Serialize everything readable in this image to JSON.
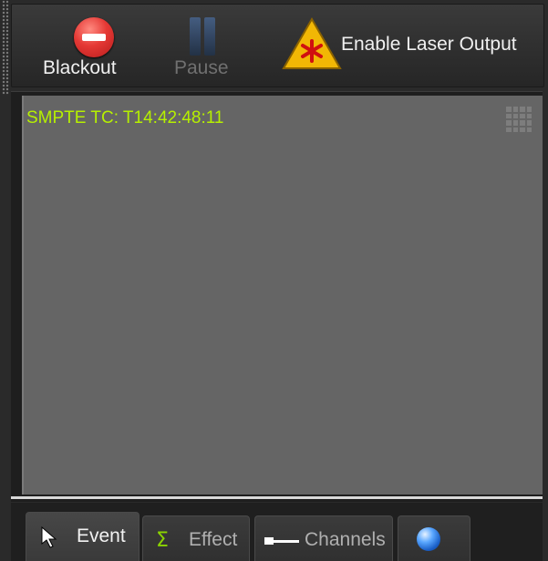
{
  "toolbar": {
    "blackout_label": "Blackout",
    "pause_label": "Pause",
    "laser_label": "Enable Laser Output"
  },
  "view": {
    "smpte": "SMPTE TC: T14:42:48:11"
  },
  "tabs": [
    {
      "label": "Event",
      "icon": "cursor-arrow-icon",
      "active": true
    },
    {
      "label": "Effect",
      "icon": "sigma-icon",
      "active": false
    },
    {
      "label": "Channels",
      "icon": "channel-fader-icon",
      "active": false
    },
    {
      "label": "",
      "icon": "globe-icon",
      "active": false
    }
  ],
  "colors": {
    "timecode": "#b6f000",
    "blackout": "#e53935",
    "warning": "#f2b705"
  }
}
